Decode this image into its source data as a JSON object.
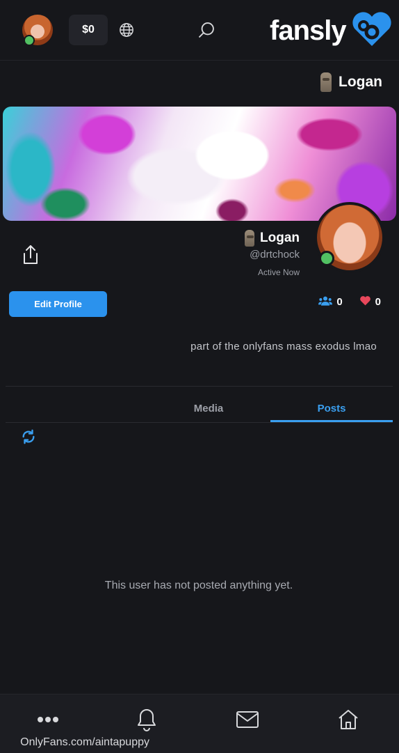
{
  "topbar": {
    "balance": "$0",
    "logo_text": "fansly",
    "icons": [
      "user-avatar",
      "globe-icon",
      "search-icon",
      "fansly-logo-icon"
    ]
  },
  "header": {
    "name": "Logan"
  },
  "profile": {
    "name": "Logan",
    "handle": "@drtchock",
    "activity": "Active Now",
    "edit_label": "Edit Profile",
    "followers": "0",
    "likes": "0",
    "bio": "part of the onlyfans mass exodus lmao"
  },
  "tabs": {
    "posts": "Posts",
    "media": "Media"
  },
  "empty_message": "This user has not posted anything yet.",
  "bottom_nav": {
    "icons": [
      "home-icon",
      "messages-icon",
      "notifications-icon",
      "more-icon"
    ],
    "url_overlay": "OnlyFans.com/aintapuppy"
  },
  "colors": {
    "accent": "#2b92ed",
    "background": "#16171b",
    "online": "#52c163",
    "heart": "#e8475b"
  }
}
